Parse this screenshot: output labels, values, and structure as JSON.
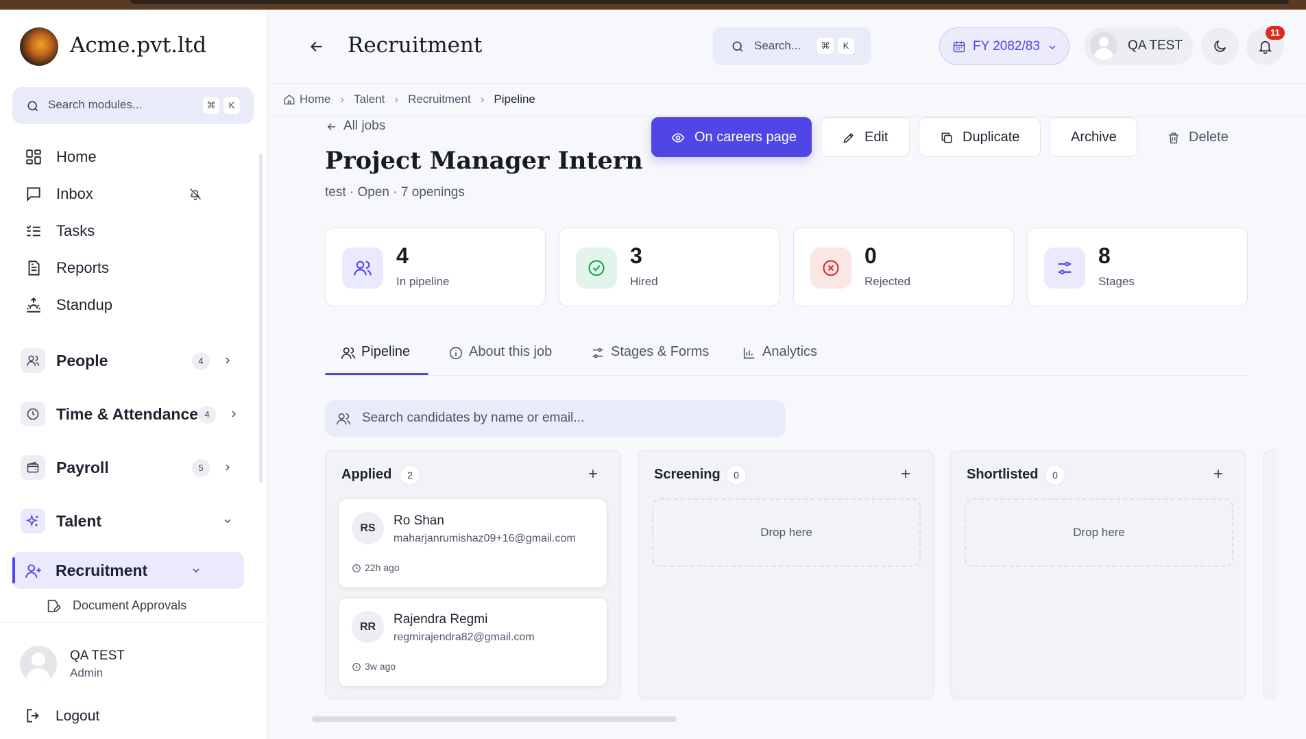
{
  "brand": {
    "name": "Acme.pvt.ltd"
  },
  "sidebar": {
    "search_placeholder": "Search modules...",
    "shortcut_cmd": "⌘",
    "shortcut_key": "K",
    "items": [
      {
        "label": "Home",
        "icon": "grid-icon"
      },
      {
        "label": "Inbox",
        "icon": "message-icon"
      },
      {
        "label": "Tasks",
        "icon": "list-icon"
      },
      {
        "label": "Reports",
        "icon": "document-icon"
      },
      {
        "label": "Standup",
        "icon": "sunrise-icon"
      }
    ],
    "groups": [
      {
        "label": "People",
        "count": "4"
      },
      {
        "label": "Time & Attendance",
        "count": "4"
      },
      {
        "label": "Payroll",
        "count": "5"
      },
      {
        "label": "Talent"
      }
    ],
    "active_item": "Recruitment",
    "sub_item": "Document Approvals",
    "user": {
      "name": "QA TEST",
      "role": "Admin"
    },
    "logout_label": "Logout"
  },
  "header": {
    "title": "Recruitment",
    "search_placeholder": "Search...",
    "shortcut_cmd": "⌘",
    "shortcut_key": "K",
    "fiscal_year": "FY 2082/83",
    "user_name": "QA TEST",
    "notification_count": "11"
  },
  "breadcrumb": [
    "Home",
    "Talent",
    "Recruitment",
    "Pipeline"
  ],
  "job": {
    "back_label": "All jobs",
    "title": "Project Manager Intern",
    "meta": "test · Open · 7 openings",
    "actions": {
      "careers": "On careers page",
      "edit": "Edit",
      "duplicate": "Duplicate",
      "archive": "Archive",
      "delete": "Delete"
    }
  },
  "stats": [
    {
      "value": "4",
      "label": "In pipeline"
    },
    {
      "value": "3",
      "label": "Hired"
    },
    {
      "value": "0",
      "label": "Rejected"
    },
    {
      "value": "8",
      "label": "Stages"
    }
  ],
  "tabs": [
    {
      "label": "Pipeline"
    },
    {
      "label": "About this job"
    },
    {
      "label": "Stages & Forms"
    },
    {
      "label": "Analytics"
    }
  ],
  "candidate_search_placeholder": "Search candidates by name or email...",
  "pipeline": {
    "columns": [
      {
        "name": "Applied",
        "count": "2",
        "cards": [
          {
            "initials": "RS",
            "name": "Ro Shan",
            "email": "maharjanrumishaz09+16@gmail.com",
            "time": "22h ago"
          },
          {
            "initials": "RR",
            "name": "Rajendra Regmi",
            "email": "regmirajendra82@gmail.com",
            "time": "3w ago"
          }
        ]
      },
      {
        "name": "Screening",
        "count": "0",
        "drop_label": "Drop here"
      },
      {
        "name": "Shortlisted",
        "count": "0",
        "drop_label": "Drop here"
      }
    ]
  },
  "colors": {
    "accent": "#4f46e5",
    "hired_green": "#16a34a",
    "rejected_red": "#dc2626",
    "badge_red": "#d92d20"
  }
}
